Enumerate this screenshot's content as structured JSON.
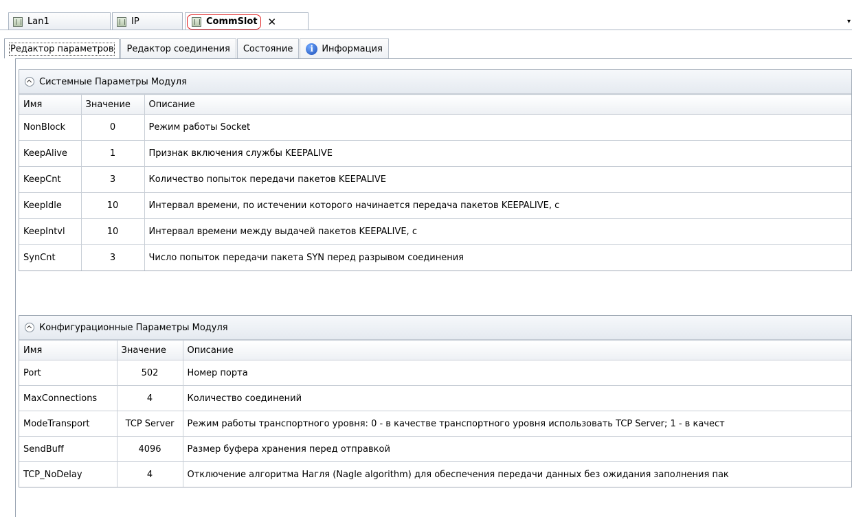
{
  "document_tabs": [
    {
      "label": "Lan1"
    },
    {
      "label": "IP"
    },
    {
      "label": "CommSlot",
      "active": true
    }
  ],
  "editor_tabs": [
    {
      "label": "Редактор параметров",
      "active": true
    },
    {
      "label": "Редактор соединения"
    },
    {
      "label": "Состояние"
    },
    {
      "label": "Информация",
      "icon": "info-icon"
    }
  ],
  "system_params": {
    "title": "Системные Параметры Модуля",
    "columns": [
      "Имя",
      "Значение",
      "Описание"
    ],
    "rows": [
      {
        "name": "NonBlock",
        "value": "0",
        "description": "Режим работы Socket"
      },
      {
        "name": "KeepAlive",
        "value": "1",
        "description": "Признак включения службы KEEPALIVE"
      },
      {
        "name": "KeepCnt",
        "value": "3",
        "description": "Количество попыток передачи пакетов KEEPALIVE"
      },
      {
        "name": "KeepIdle",
        "value": "10",
        "description": "Интервал времени, по истечении которого начинается передача пакетов KEEPALIVE, с"
      },
      {
        "name": "KeepIntvl",
        "value": "10",
        "description": "Интервал времени между выдачей пакетов KEEPALIVE, с"
      },
      {
        "name": "SynCnt",
        "value": "3",
        "description": "Число попыток передачи пакета SYN перед разрывом соединения"
      }
    ]
  },
  "config_params": {
    "title": "Конфигурационные Параметры Модуля",
    "columns": [
      "Имя",
      "Значение",
      "Описание"
    ],
    "rows": [
      {
        "name": "Port",
        "value": "502",
        "description": "Номер порта"
      },
      {
        "name": "MaxConnections",
        "value": "4",
        "description": "Количество соединений"
      },
      {
        "name": "ModeTransport",
        "value": "TCP Server",
        "description": "Режим работы транспортного уровня: 0 - в качестве транспортного уровня использовать TCP Server; 1 - в качест"
      },
      {
        "name": "SendBuff",
        "value": "4096",
        "description": "Размер буфера хранения перед отправкой"
      },
      {
        "name": "TCP_NoDelay",
        "value": "4",
        "description": "Отключение алгоритма Нагля (Nagle algorithm) для обеспечения передачи данных без ожидания заполнения пак"
      }
    ]
  },
  "colors": {
    "highlight_outline": "#e02020",
    "info_icon": "#1d4fb8",
    "border": "#a0aab6"
  }
}
